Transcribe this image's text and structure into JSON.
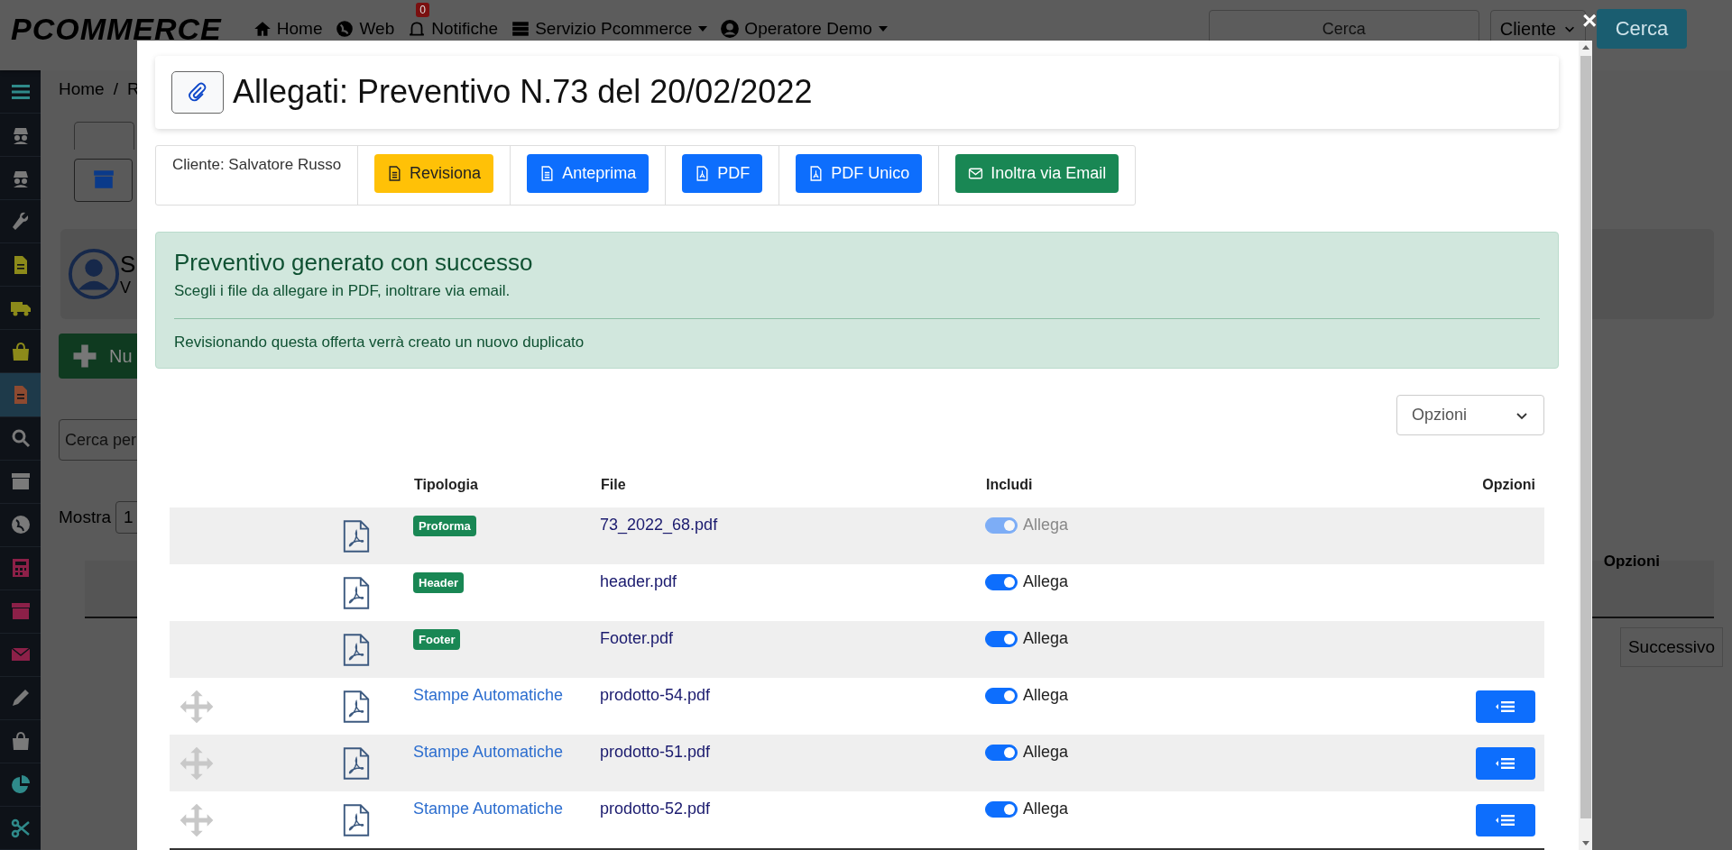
{
  "topbar": {
    "logo": "PCOMMERCE",
    "nav": [
      {
        "label": "Home",
        "dropdown": false
      },
      {
        "label": "Web",
        "dropdown": false
      },
      {
        "label": "Notifiche",
        "badge": "0",
        "dropdown": false
      },
      {
        "label": "Servizio Pcommerce",
        "dropdown": true
      },
      {
        "label": "Operatore Demo",
        "dropdown": true
      }
    ],
    "search": {
      "placeholder": "Cerca"
    },
    "scope_select": "Cliente",
    "search_button": "Cerca"
  },
  "sidebar": {
    "items": [
      {
        "color": "#2f8a8a",
        "selected": false
      },
      {
        "color": "#7a7a7a",
        "selected": false
      },
      {
        "color": "#7a7a7a",
        "selected": false
      },
      {
        "color": "#7a7a7a",
        "selected": false
      },
      {
        "color": "#8c8a1a",
        "selected": false
      },
      {
        "color": "#8c8a1a",
        "selected": false
      },
      {
        "color": "#8c8a1a",
        "selected": false
      },
      {
        "color": "#8e4a30",
        "selected": true
      },
      {
        "color": "#7a7a7a",
        "selected": false
      },
      {
        "color": "#7a7a7a",
        "selected": false
      },
      {
        "color": "#7a7a7a",
        "selected": false
      },
      {
        "color": "#8c2048",
        "selected": false
      },
      {
        "color": "#8c2048",
        "selected": false
      },
      {
        "color": "#8c2048",
        "selected": false
      },
      {
        "color": "#7a7a7a",
        "selected": false
      },
      {
        "color": "#7a7a7a",
        "selected": false
      },
      {
        "color": "#2f8a8a",
        "selected": false
      },
      {
        "color": "#2f8a8a",
        "selected": false
      }
    ]
  },
  "page": {
    "breadcrumb": [
      "Home",
      "R"
    ],
    "breadcrumb_separator": "/",
    "customer_initial": "S",
    "customer_sub": "V",
    "new_button": "Nu",
    "search_placeholder": "Cerca per",
    "show_label": "Mostra",
    "show_value": "1",
    "table_header": "Opzioni",
    "pager_next": "Successivo"
  },
  "modal": {
    "close": "×",
    "title": "Allegati: Preventivo N.73 del 20/02/2022",
    "client": "Cliente: Salvatore Russo",
    "actions": [
      {
        "label": "Revisiona",
        "kind": "revise"
      },
      {
        "label": "Anteprima",
        "kind": "preview"
      },
      {
        "label": "PDF",
        "kind": "pdf"
      },
      {
        "label": "PDF Unico",
        "kind": "pdf"
      },
      {
        "label": "Inoltra via Email",
        "kind": "email"
      }
    ],
    "alert": {
      "heading": "Preventivo generato con successo",
      "text": "Scegli i file da allegare in PDF, inoltrare via email.",
      "note": "Revisionando questa offerta verrà creato un nuovo duplicato"
    },
    "options_select": "Opzioni",
    "columns": [
      "Tipologia",
      "File",
      "Includi",
      "Opzioni"
    ],
    "rows": [
      {
        "kind": "badge",
        "type": "Proforma",
        "file": "73_2022_68.pdf",
        "include_label": "Allega",
        "checked": true,
        "disabled": true,
        "draggable": false,
        "has_options": false
      },
      {
        "kind": "badge",
        "type": "Header",
        "file": "header.pdf",
        "include_label": "Allega",
        "checked": true,
        "disabled": false,
        "draggable": false,
        "has_options": false
      },
      {
        "kind": "badge",
        "type": "Footer",
        "file": "Footer.pdf",
        "include_label": "Allega",
        "checked": true,
        "disabled": false,
        "draggable": false,
        "has_options": false
      },
      {
        "kind": "link",
        "type": "Stampe Automatiche",
        "file": "prodotto-54.pdf",
        "include_label": "Allega",
        "checked": true,
        "disabled": false,
        "draggable": true,
        "has_options": true
      },
      {
        "kind": "link",
        "type": "Stampe Automatiche",
        "file": "prodotto-51.pdf",
        "include_label": "Allega",
        "checked": true,
        "disabled": false,
        "draggable": true,
        "has_options": true
      },
      {
        "kind": "link",
        "type": "Stampe Automatiche",
        "file": "prodotto-52.pdf",
        "include_label": "Allega",
        "checked": true,
        "disabled": false,
        "draggable": true,
        "has_options": true
      }
    ]
  }
}
